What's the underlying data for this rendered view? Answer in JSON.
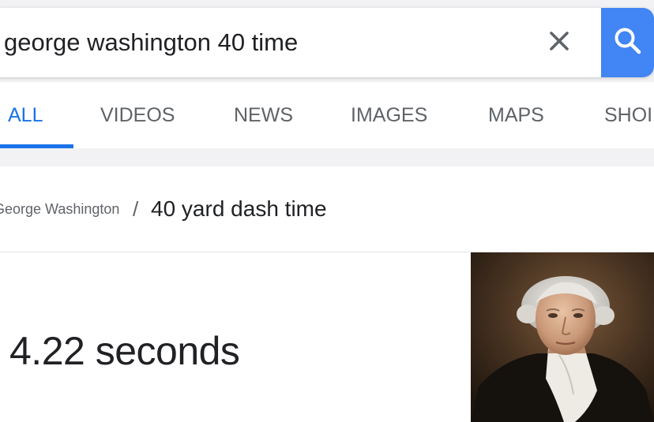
{
  "search": {
    "query": "george washington 40 time"
  },
  "tabs": [
    {
      "label": "ALL",
      "active": true
    },
    {
      "label": "VIDEOS",
      "active": false
    },
    {
      "label": "NEWS",
      "active": false
    },
    {
      "label": "IMAGES",
      "active": false
    },
    {
      "label": "MAPS",
      "active": false
    },
    {
      "label": "SHOI",
      "active": false
    }
  ],
  "breadcrumb": {
    "entity": "George Washington",
    "separator": "/",
    "attribute": "40 yard dash time"
  },
  "answer": {
    "value": "4.22 seconds"
  },
  "icons": {
    "clear": "close-icon",
    "search": "search-icon",
    "portrait": "portrait-image"
  },
  "colors": {
    "accent": "#1a73e8",
    "search_button": "#4285f4",
    "text_primary": "#202124",
    "text_secondary": "#5f6368"
  }
}
